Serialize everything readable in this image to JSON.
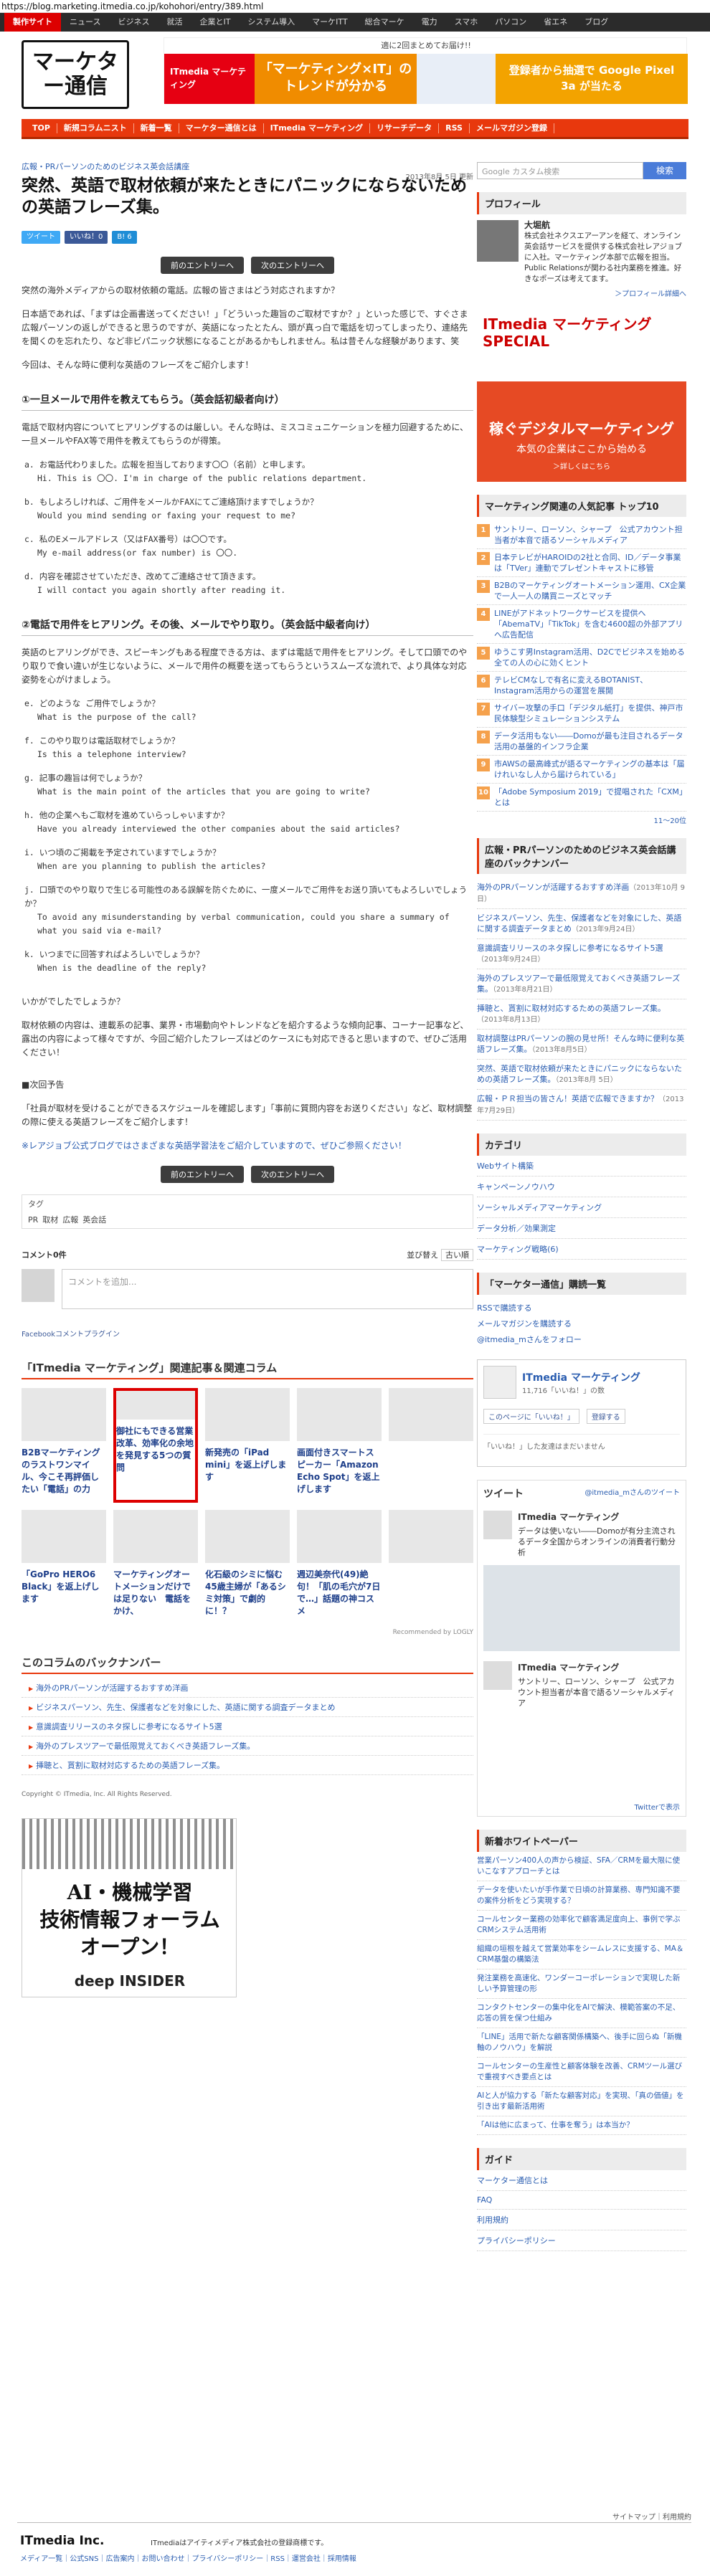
{
  "url": "https://blog.marketing.itmedia.co.jp/kohohori/entry/389.html",
  "topnav": [
    "製作サイト",
    "ニュース",
    "ビジネス",
    "就活",
    "企業とIT",
    "システム導入",
    "マーケITT",
    "総合マーケ",
    "電力",
    "スマホ",
    "パソコン",
    "省エネ",
    "ブログ"
  ],
  "logo": "マーケター通信",
  "banner": {
    "head": "適に2回まとめてお届け!!",
    "brand": "ITmedia マーケティング",
    "mid": "「マーケティング×IT」のトレンドが分かる",
    "right": "登録者から抽選で Google Pixel 3a が当たる"
  },
  "rednav": [
    "TOP",
    "新規コラムニスト",
    "新着一覧",
    "マーケター通信とは",
    "ITmedia マーケティング",
    "リサーチデータ",
    "RSS",
    "メールマガジン登録"
  ],
  "article": {
    "category": "広報・PRパーソンのためのビジネス英会話講座",
    "date": "2013年8月 5日 更新",
    "title": "突然、英語で取材依頼が来たときにパニックにならないための英語フレーズ集。",
    "share": {
      "tweet": "ツイート",
      "like": "いいね！0",
      "hatena": "B! 6"
    },
    "prev": "前のエントリーへ",
    "next": "次のエントリーへ",
    "p1": "突然の海外メディアからの取材依頼の電話。広報の皆さまはどう対応されますか？",
    "p2": "日本語であれば、「まずは企画書送ってください！」「どういった趣旨のご取材ですか？」といった感じで、すぐさま広報パーソンの返しができると思うのですが、英語になったとたん、頭が真っ白で電話を切ってしまったり、連絡先を聞くのを忘れたり、など非ビパニック状態になることがあるかもしれません。私は昔そんな経験があります、笑",
    "p3": "今回は、そんな時に便利な英語のフレーズをご紹介します！",
    "sec1": "①一旦メールで用件を教えてもらう。（英会話初級者向け）",
    "p4": "電話で取材内容についてヒアリングするのは厳しい。そんな時は、ミスコミュニケーションを極力回避するために、一旦メールやFAX等で用件を教えてもらうのが得策。",
    "q1": [
      {
        "ja": "a. お電話代わりました。広報を担当しております〇〇（名前）と申します。",
        "en": "Hi. This is 〇〇. I'm in charge of the public relations department."
      },
      {
        "ja": "b. もしよろしければ、ご用件をメールかFAXにてご連絡頂けますでしょうか？",
        "en": "Would you mind sending or faxing your request to me?"
      },
      {
        "ja": "c. 私のEメールアドレス（又はFAX番号）は〇〇です。",
        "en": "My e-mail address(or fax number) is 〇〇."
      },
      {
        "ja": "d. 内容を確認させていただき、改めてご連絡させて頂きます。",
        "en": "I will contact you again shortly after reading it."
      }
    ],
    "sec2": "②電話で用件をヒアリング。その後、メールでやり取り。（英会話中級者向け）",
    "p5": "英語のヒアリングができ、スピーキングもある程度できる方は、まずは電話で用件をヒアリング。そして口頭でのやり取りで食い違いが生じないように、メールで用件の概要を送ってもらうというスムーズな流れで、より具体な対応姿勢を心がけましょう。",
    "q2": [
      {
        "ja": "e. どのような ご用件でしょうか？",
        "en": "What is the purpose of the call?"
      },
      {
        "ja": "f. このやり取りは電話取材でしょうか？",
        "en": "Is this a telephone interview?"
      },
      {
        "ja": "g. 記事の趣旨は何でしょうか？",
        "en": "What is the main point of the articles that you are going to write?"
      },
      {
        "ja": "h. 他の企業へもご取材を進めていらっしゃいますか？",
        "en": "Have you already interviewed the other companies about the said articles?"
      },
      {
        "ja": "i. いつ頃のご掲載を予定されていますでしょうか？",
        "en": "When are you planning to publish the articles?"
      },
      {
        "ja": "j. 口頭でのやり取りで生じる可能性のある誤解を防ぐために、一度メールでご用件をお送り頂いてもよろしいでしょうか？",
        "en": "To avoid any misunderstanding by verbal communication, could you share a summary of what you said via e-mail?"
      },
      {
        "ja": "k. いつまでに回答すればよろしいでしょうか？",
        "en": "When is the deadline of the reply?"
      }
    ],
    "p6": "いかがでしたでしょうか？",
    "p7": "取材依頼の内容は、連載系の記事、業界・市場動向やトレンドなどを紹介するような傾向記事、コーナー記事など、露出の内容によって様々ですが、今回ご紹介したフレーズはどのケースにも対応できると思いますので、ぜひご活用ください！",
    "next_head": "■次回予告",
    "p8": "「社員が取材を受けることができるスケジュールを確認します」「事前に質問内容をお送りください」など、取材調整の際に使える英語フレーズをご紹介します！",
    "p9": "※レアジョブ公式ブログではさまざまな英語学習法をご紹介していますので、ぜひご参照ください！",
    "tag_label": "タグ",
    "tags": [
      "PR",
      "取材",
      "広報",
      "英会話"
    ],
    "comments": "コメント0件",
    "sort": "並び替え",
    "sort_value": "古い順",
    "comment_placeholder": "コメントを追加...",
    "fb_plugin": "Facebookコメントプラグイン"
  },
  "related": {
    "head": "「ITmedia マーケティング」関連記事＆関連コラム",
    "items": [
      "B2Bマーケティングのラストワンマイル、今こそ再評価したい「電話」の力",
      "御社にもできる営業改革、効率化の余地を発見する5つの質問",
      "新発売の「iPad mini」を返上げします",
      "画面付きスマートスピーカー「Amazon Echo Spot」を返上げします",
      "",
      "「GoPro HERO6 Black」を返上げします",
      "マーケティングオートメーションだけでは足りない　電話をかけ、",
      "化石級のシミに悩む45歳主婦が「あるシミ対策」で劇的に！？",
      "週辺美奈代(49)絶句！「肌の毛穴が7日で…」話題の神コスメ",
      ""
    ],
    "recommended": "Recommended by LOGLY"
  },
  "backnumber": {
    "head": "このコラムのバックナンバー",
    "items": [
      "海外のPRパーソンが活躍するおすすめ洋画",
      "ビジネスパーソン、先生、保護者などを対象にした、英語に関する調査データまとめ",
      "意識調査リリースのネタ探しに参考になるサイト5選",
      "海外のプレスツアーで最低限覚えておくべき英語フレーズ集。",
      "挿聴と、貰割に取材対応するための英語フレーズ集。"
    ]
  },
  "copyright": "Copyright © ITmedia, Inc. All Rights Reserved.",
  "aiad": {
    "text": "AI・機械学習\n技術情報フォーラム\nオープン！",
    "logo": "deep INSIDER"
  },
  "sidebar": {
    "search_placeholder": "Google カスタム検索",
    "search_btn": "検索",
    "profile_head": "プロフィール",
    "profile_name": "大堀航",
    "profile_text": "株式会社ネクスエアーアンを経て、オンライン英会話サービスを提供する株式会社レアジョブに入社。マーケティング本部で広報を担当。Public Relationsが関わる社内業務を推進。好きなポーズは考えてます。",
    "profile_more": "＞プロフィール詳細へ",
    "ad_title": "ITmedia マーケティング SPECIAL",
    "ad_msg": "稼ぐデジタルマーケティング",
    "ad_sub": "本気の企業はここから始める",
    "ad_more": "＞詳しくはこちら",
    "rank_head": "マーケティング関連の人気記事 トップ10",
    "rank": [
      "サントリー、ローソン、シャープ　公式アカウント担当者が本音で語るソーシャルメディア",
      "日本テレビがHAROIDの2社と合同、ID／データ事業は「TVer」連動でプレゼントキャストに移管",
      "B2Bのマーケティングオートメーション運用、CX企業で一人一人の購買ニーズとマッチ",
      "LINEがアドネットワークサービスを提供へ「AbemaTV」「TikTok」を含む4600超の外部アプリへ広告配信",
      "ゆうこす男Instagram活用、D2Cでビジネスを始める全ての人の心に効くヒント",
      "テレビCMなしで有名に変えるBOTANIST、Instagram活用からの運営を展開",
      "サイバー攻撃の手口「デジタル紙打」を提供、神戸市民体験型シミュレーションシステム",
      "データ活用もない――Domoが最も注目されるデータ活用の基盤的インフラ企業",
      "市AWSの最高峰式が語るマーケティングの基本は「届けれいなし人から届けられている」",
      "「Adobe Symposium 2019」で提唱された「CXM」とは"
    ],
    "rank_more": "1〜10位",
    "rank_more2": "11〜20位",
    "series_head": "広報・PRパーソンのためのビジネス英会話講座のバックナンバー",
    "series": [
      {
        "t": "海外のPRパーソンが活躍するおすすめ洋画",
        "d": "（2013年10月 9日）"
      },
      {
        "t": "ビジネスパーソン、先生、保護者などを対象にした、英語に関する調査データまとめ",
        "d": "（2013年9月24日）"
      },
      {
        "t": "意識調査リリースのネタ探しに参考になるサイト5選",
        "d": "（2013年9月24日）"
      },
      {
        "t": "海外のプレスツアーで最低限覚えておくべき英語フレーズ集。",
        "d": "（2013年8月21日）"
      },
      {
        "t": "挿聴と、貰割に取材対応するための英語フレーズ集。",
        "d": "（2013年8月13日）"
      },
      {
        "t": "取材調整はPRパーソンの腕の見せ所！そんな時に便利な英語フレーズ集。",
        "d": "（2013年8月5日）"
      },
      {
        "t": "突然、英語で取材依頼が来たときにパニックにならないための英語フレーズ集。",
        "d": "（2013年8月 5日）"
      },
      {
        "t": "広報・ＰＲ担当の皆さん！英語で広報できますか？",
        "d": "（2013年7月29日）"
      }
    ],
    "category_head": "カテゴリ",
    "categories": [
      "Webサイト構築",
      "キャンペーンノウハウ",
      "ソーシャルメディアマーケティング",
      "データ分析／効果測定",
      "マーケティング戦略(6)"
    ],
    "subscribe_head": "「マーケター通信」購読一覧",
    "subscribe": [
      "RSSで購読する",
      "メールマガジンを購読する",
      "@itmedia_mさんをフォロー"
    ],
    "fb_name": "ITmedia マーケティング",
    "fb_count": "11,716「いいね！」の数",
    "fb_like": "このページに「いいね！」",
    "fb_reg": "登録する",
    "fb_note": "「いいね！」した友達はまだいません",
    "tw_label": "@itmedia_mさんのツイート",
    "tw_head": "ツイート",
    "tw_name": "ITmedia マーケティング",
    "tw_text": "データは使いない――Domoが有分主流されるデータ全国からオンラインの消費者行動分析",
    "tw_text2": "サントリー、ローソン、シャープ　公式アカウント担当者が本音で語るソーシャルメディア",
    "tw_link": "Twitterで表示",
    "wp_head": "新着ホワイトペーパー",
    "wp": [
      "営業パーソン400人の声から検証、SFA／CRMを最大限に使いこなすアプローチとは",
      "データを使いたいが手作業で日頃の計算業務、専門知識不要の案件分析をどう実現する？",
      "コールセンター業務の効率化で顧客満足度向上、事例で学ぶCRMシステム活用術",
      "組織の垣根を越えて営業効率をシームレスに支援する、MA＆CRM基盤の構築法",
      "発注業務を高速化、ワンダーコーポレーションで実現した新しい予算管理の形",
      "コンタクトセンターの集中化をAIで解決、模範答案の不足、応答の質を保つ仕組み",
      "「LINE」活用で新たな顧客関係構築へ、後手に回らぬ「新機軸のノウハウ」を解説",
      "コールセンターの生産性と顧客体験を改善、CRMツール選びで重視すべき要点とは",
      "AIと人が協力する「新たな顧客対応」を実現、「真の価値」を引き出す最新活用術",
      "「AIは他に広まって、仕事を奪う」は本当か？"
    ],
    "guide_head": "ガイド",
    "guide": [
      "マーケター通信とは",
      "FAQ",
      "利用規約",
      "プライバシーポリシー"
    ]
  },
  "footer": {
    "top": "サイトマップ｜利用規約",
    "brand": "ITmedia Inc.",
    "sub": "ITmediaはアイティメディア株式会社の登録商標です。",
    "links": "メディア一覧｜公式SNS｜広告案内｜お問い合わせ｜プライバシーポリシー｜RSS｜運営会社｜採用情報"
  }
}
